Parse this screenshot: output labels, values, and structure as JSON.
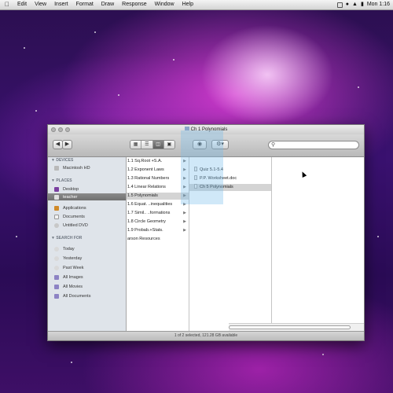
{
  "menubar": {
    "items": [
      "Edit",
      "View",
      "Insert",
      "Format",
      "Draw",
      "Response",
      "Window",
      "Help"
    ],
    "clock": "Mon 1:16"
  },
  "window": {
    "title": "Ch 1 Polynomials",
    "status": "1 of 2 selected, 121.28 GB available"
  },
  "sidebar": {
    "sections": [
      {
        "label": "▼ DEVICES",
        "items": [
          {
            "label": "Macintosh HD",
            "selected": false
          }
        ]
      },
      {
        "label": "▼ PLACES",
        "items": [
          {
            "label": "Desktop",
            "selected": false
          },
          {
            "label": "teacher",
            "selected": true
          },
          {
            "label": "Applications",
            "selected": false
          },
          {
            "label": "Documents",
            "selected": false
          },
          {
            "label": "Untitled DVD",
            "selected": false
          }
        ]
      },
      {
        "label": "▼ SEARCH FOR",
        "items": [
          {
            "label": "Today",
            "selected": false
          },
          {
            "label": "Yesterday",
            "selected": false
          },
          {
            "label": "Past Week",
            "selected": false
          },
          {
            "label": "All Images",
            "selected": false
          },
          {
            "label": "All Movies",
            "selected": false
          },
          {
            "label": "All Documents",
            "selected": false
          }
        ]
      }
    ]
  },
  "column1": {
    "items": [
      {
        "label": "1.1 Sq.Root +S.A.",
        "selected": false
      },
      {
        "label": "1.2 Exponent Laws",
        "selected": false
      },
      {
        "label": "1.3 Rational Numbers",
        "selected": false
      },
      {
        "label": "1.4 Linear Relations",
        "selected": false
      },
      {
        "label": "1.5 Polynomials",
        "selected": true
      },
      {
        "label": "1.6 Equat. ..inequalities",
        "selected": false
      },
      {
        "label": "1.7 Simil.. ..formations",
        "selected": false
      },
      {
        "label": "1.8 Circle Geometry",
        "selected": false
      },
      {
        "label": "1.9 Probab.+Stats.",
        "selected": false
      },
      {
        "label": "arson Resources",
        "selected": false
      }
    ]
  },
  "column2": {
    "items": [
      {
        "label": "Quiz 5.1-5.4",
        "selected": false
      },
      {
        "label": "P.P. Worksheet.doc",
        "selected": false
      },
      {
        "label": "Ch 5 Polynomials",
        "selected": true
      }
    ]
  }
}
